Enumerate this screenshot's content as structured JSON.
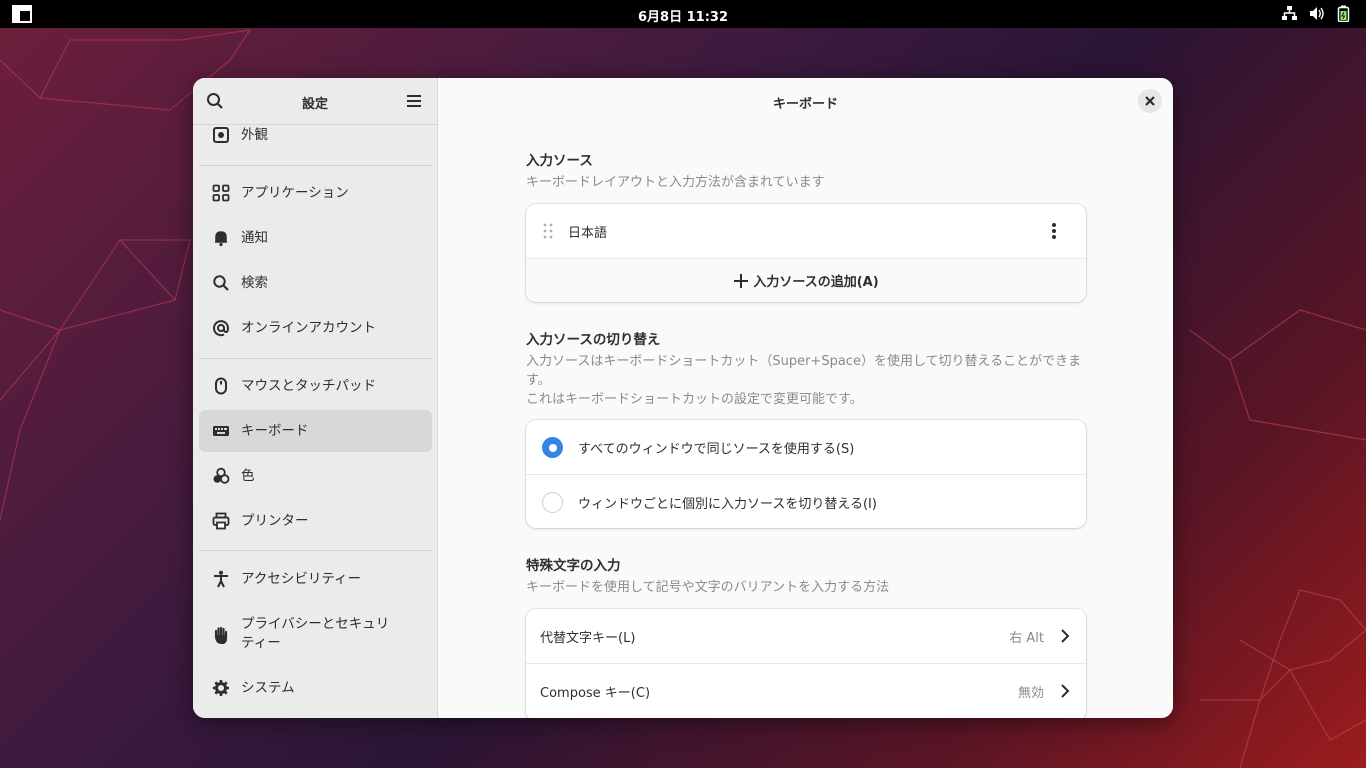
{
  "topbar": {
    "clock": "6月8日 11:32",
    "icons": [
      "activities-icon",
      "network-icon",
      "volume-icon",
      "battery-icon"
    ]
  },
  "sidebar": {
    "title": "設定",
    "items": [
      {
        "label": "外観",
        "icon": "appearance-icon"
      },
      {
        "label": "アプリケーション",
        "icon": "apps-grid-icon"
      },
      {
        "label": "通知",
        "icon": "bell-icon"
      },
      {
        "label": "検索",
        "icon": "search-icon"
      },
      {
        "label": "オンラインアカウント",
        "icon": "at-icon"
      },
      {
        "label": "マウスとタッチパッド",
        "icon": "mouse-icon"
      },
      {
        "label": "キーボード",
        "icon": "keyboard-icon",
        "active": true
      },
      {
        "label": "色",
        "icon": "color-icon"
      },
      {
        "label": "プリンター",
        "icon": "printer-icon"
      },
      {
        "label": "アクセシビリティー",
        "icon": "accessibility-icon"
      },
      {
        "label": "プライバシーとセキュリティー",
        "label_line1": "プライバシーとセキュリ",
        "label_line2": "ティー",
        "icon": "hand-icon"
      },
      {
        "label": "システム",
        "icon": "gear-icon"
      }
    ]
  },
  "main": {
    "title": "キーボード",
    "input_sources": {
      "title": "入力ソース",
      "desc": "キーボードレイアウトと入力方法が含まれています",
      "items": [
        "日本語"
      ],
      "add_label": "入力ソースの追加(A)"
    },
    "switching": {
      "title": "入力ソースの切り替え",
      "desc_line1": "入力ソースはキーボードショートカット（Super+Space）を使用して切り替えることができま",
      "desc_line2": "す。",
      "desc_line3": "これはキーボードショートカットの設定で変更可能です。",
      "options": [
        {
          "label": "すべてのウィンドウで同じソースを使用する(S)",
          "selected": true
        },
        {
          "label": "ウィンドウごとに個別に入力ソースを切り替える(I)",
          "selected": false
        }
      ]
    },
    "special": {
      "title": "特殊文字の入力",
      "desc": "キーボードを使用して記号や文字のバリアントを入力する方法",
      "rows": [
        {
          "label": "代替文字キー(L)",
          "value": "右 Alt"
        },
        {
          "label": "Compose キー(C)",
          "value": "無効"
        }
      ]
    }
  },
  "colors": {
    "accent": "#3584e4",
    "topbar": "#000000",
    "sidebar": "#ebebeb"
  }
}
